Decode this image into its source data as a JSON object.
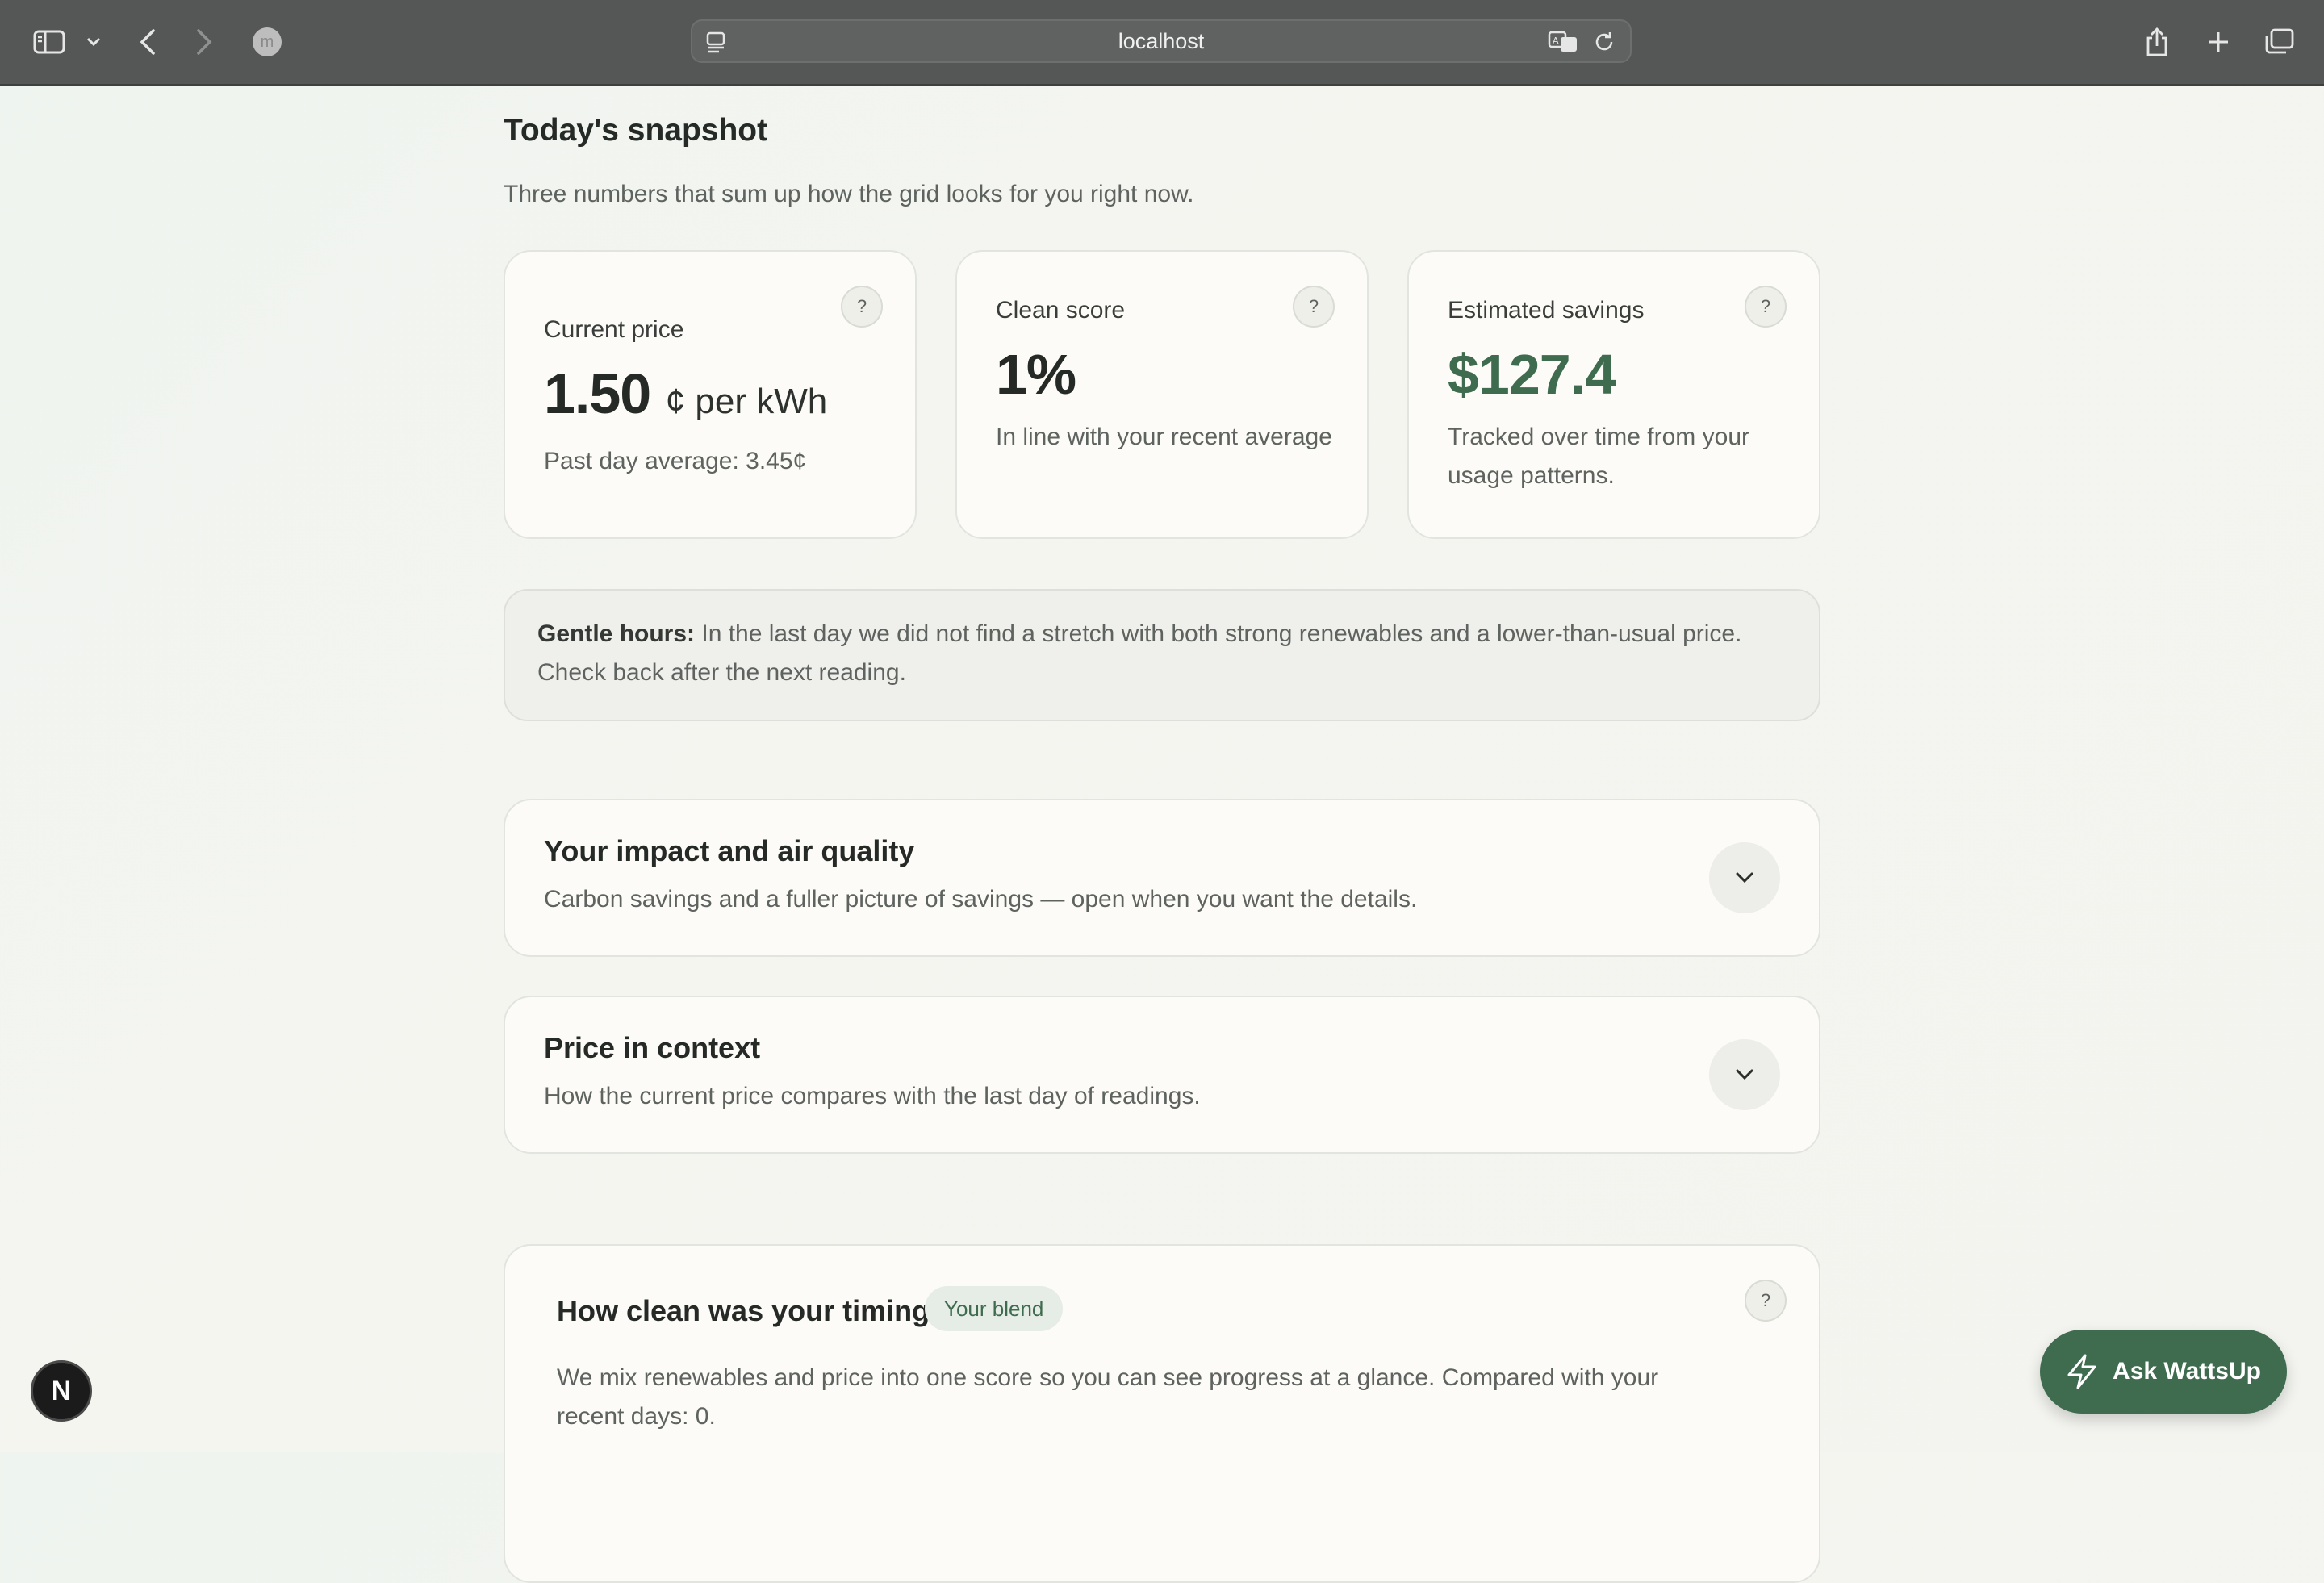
{
  "browser": {
    "url": "localhost",
    "profile_initial": "m",
    "icons": [
      "sidebar-icon",
      "chevron-down-icon",
      "back-icon",
      "forward-icon",
      "reader-icon",
      "translate-icon",
      "reload-icon",
      "share-icon",
      "plus-icon",
      "tabs-icon"
    ]
  },
  "snapshot": {
    "title": "Today's snapshot",
    "subtitle": "Three numbers that sum up how the grid looks for you right now.",
    "help_label": "?",
    "cards": [
      {
        "label": "Current price",
        "value": "1.50",
        "unit": "¢ per kWh",
        "note": "Past day average: 3.45¢"
      },
      {
        "label": "Clean score",
        "value": "1%",
        "note": "In line with your recent average"
      },
      {
        "label": "Estimated savings",
        "value": "$127.4",
        "note": "Tracked over time from your usage patterns."
      }
    ]
  },
  "notice": {
    "lead": "Gentle hours:",
    "text": "In the last day we did not find a stretch with both strong renewables and a lower-than-usual price. Check back after the next reading."
  },
  "sections": [
    {
      "title": "Your impact and air quality",
      "subtitle": "Carbon savings and a fuller picture of savings — open when you want the details."
    },
    {
      "title": "Price in context",
      "subtitle": "How the current price compares with the last day of readings."
    }
  ],
  "timing": {
    "title": "How clean was your timing?",
    "pill": "Your blend",
    "body": "We mix renewables and price into one score so you can see progress at a glance. Compared with your recent days: 0."
  },
  "assistant": {
    "label": "Ask WattsUp"
  },
  "dev_badge": {
    "letter": "N"
  },
  "colors": {
    "accent": "#3f6b4e",
    "background": "#f3f4ef",
    "chrome": "#555757"
  }
}
